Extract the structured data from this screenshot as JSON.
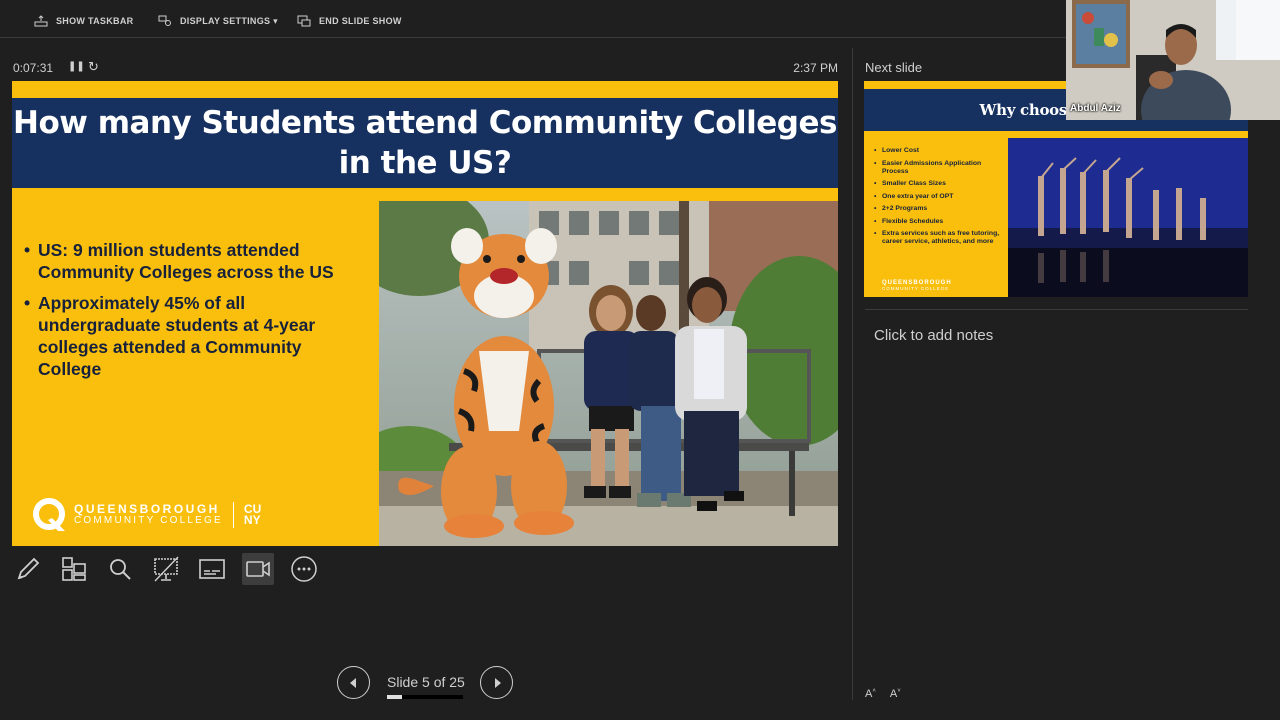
{
  "topbar": {
    "show_taskbar": "SHOW TASKBAR",
    "display_settings": "DISPLAY SETTINGS ▾",
    "end_slide_show": "END SLIDE SHOW"
  },
  "presenter": {
    "elapsed": "0:07:31",
    "clock": "2:37 PM"
  },
  "current_slide": {
    "title_line1": "How many Students attend Community Colleges",
    "title_line2": "in the US?",
    "bullets": [
      "US: 9 million students attended Community Colleges across the US",
      "Approximately 45% of all undergraduate students at 4-year colleges attended a Community College"
    ],
    "logo_line1": "QUEENSBOROUGH",
    "logo_line2": "COMMUNITY COLLEGE",
    "logo_cuny1": "CU",
    "logo_cuny2": "NY"
  },
  "navigation": {
    "counter": "Slide 5 of 25",
    "progress_fraction": 0.2
  },
  "next_slide": {
    "label": "Next slide",
    "title": "Why choose a Com",
    "bullets": [
      "Lower Cost",
      "Easier Admissions Application Process",
      "Smaller Class Sizes",
      " One extra year of OPT",
      "2+2 Programs",
      "Flexible Schedules",
      "Extra services such as free tutoring, career service, athletics, and more"
    ],
    "logo_text": "QUEENSBOROUGH",
    "logo_sub": "COMMUNITY COLLEGE",
    "logo_cuny": "CUNY"
  },
  "notes": {
    "placeholder": "Click to add notes"
  },
  "webcam": {
    "name": "Abdul Aziz"
  },
  "colors": {
    "slide_gold": "#f9bf0c",
    "slide_navy": "#16305f",
    "background": "#1f1f1f"
  }
}
